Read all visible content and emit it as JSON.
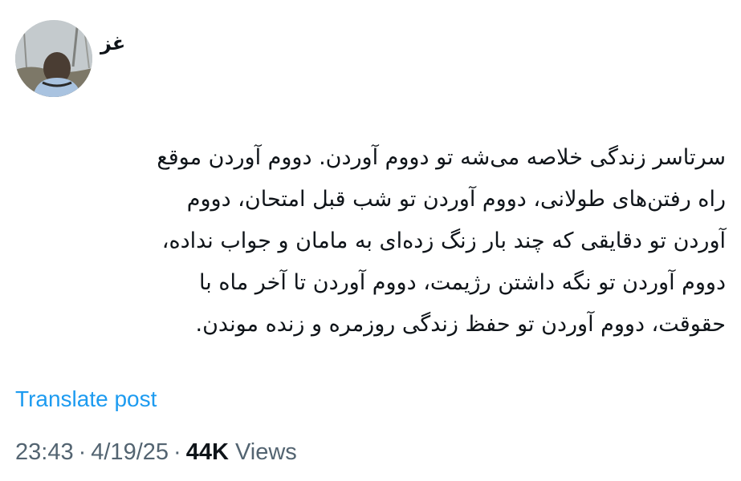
{
  "author": {
    "name": "غز",
    "avatar_icon": "profile-photo"
  },
  "post": {
    "lines": [
      "سرتاسر زندگی خلاصه می‌شه تو دووم آوردن. دووم آوردن موقع",
      "راه رفتن‌های طولانی، دووم آوردن تو شب قبل امتحان، دووم",
      "آوردن تو دقایقی که چند بار زنگ زده‌ای به مامان و جواب نداده،",
      "دووم آوردن تو نگه داشتن رژیمت، دووم آوردن تا آخر ماه با",
      "حقوقت، دووم آوردن تو حفظ زندگی روزمره و زنده موندن."
    ]
  },
  "translate_label": "Translate post",
  "meta": {
    "time": "23:43",
    "separator": "·",
    "date": "4/19/25",
    "views_count": "44K",
    "views_label": "Views"
  },
  "colors": {
    "link": "#1d9bf0",
    "secondary_text": "#536471",
    "primary_text": "#0f1419"
  }
}
